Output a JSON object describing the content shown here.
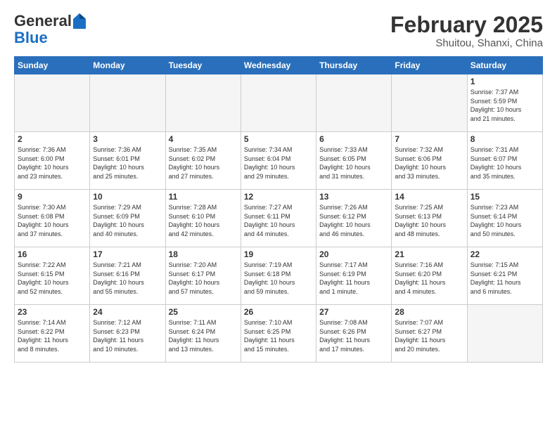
{
  "header": {
    "logo_general": "General",
    "logo_blue": "Blue",
    "month_title": "February 2025",
    "subtitle": "Shuitou, Shanxi, China"
  },
  "days_of_week": [
    "Sunday",
    "Monday",
    "Tuesday",
    "Wednesday",
    "Thursday",
    "Friday",
    "Saturday"
  ],
  "weeks": [
    [
      {
        "num": "",
        "info": ""
      },
      {
        "num": "",
        "info": ""
      },
      {
        "num": "",
        "info": ""
      },
      {
        "num": "",
        "info": ""
      },
      {
        "num": "",
        "info": ""
      },
      {
        "num": "",
        "info": ""
      },
      {
        "num": "1",
        "info": "Sunrise: 7:37 AM\nSunset: 5:59 PM\nDaylight: 10 hours\nand 21 minutes."
      }
    ],
    [
      {
        "num": "2",
        "info": "Sunrise: 7:36 AM\nSunset: 6:00 PM\nDaylight: 10 hours\nand 23 minutes."
      },
      {
        "num": "3",
        "info": "Sunrise: 7:36 AM\nSunset: 6:01 PM\nDaylight: 10 hours\nand 25 minutes."
      },
      {
        "num": "4",
        "info": "Sunrise: 7:35 AM\nSunset: 6:02 PM\nDaylight: 10 hours\nand 27 minutes."
      },
      {
        "num": "5",
        "info": "Sunrise: 7:34 AM\nSunset: 6:04 PM\nDaylight: 10 hours\nand 29 minutes."
      },
      {
        "num": "6",
        "info": "Sunrise: 7:33 AM\nSunset: 6:05 PM\nDaylight: 10 hours\nand 31 minutes."
      },
      {
        "num": "7",
        "info": "Sunrise: 7:32 AM\nSunset: 6:06 PM\nDaylight: 10 hours\nand 33 minutes."
      },
      {
        "num": "8",
        "info": "Sunrise: 7:31 AM\nSunset: 6:07 PM\nDaylight: 10 hours\nand 35 minutes."
      }
    ],
    [
      {
        "num": "9",
        "info": "Sunrise: 7:30 AM\nSunset: 6:08 PM\nDaylight: 10 hours\nand 37 minutes."
      },
      {
        "num": "10",
        "info": "Sunrise: 7:29 AM\nSunset: 6:09 PM\nDaylight: 10 hours\nand 40 minutes."
      },
      {
        "num": "11",
        "info": "Sunrise: 7:28 AM\nSunset: 6:10 PM\nDaylight: 10 hours\nand 42 minutes."
      },
      {
        "num": "12",
        "info": "Sunrise: 7:27 AM\nSunset: 6:11 PM\nDaylight: 10 hours\nand 44 minutes."
      },
      {
        "num": "13",
        "info": "Sunrise: 7:26 AM\nSunset: 6:12 PM\nDaylight: 10 hours\nand 46 minutes."
      },
      {
        "num": "14",
        "info": "Sunrise: 7:25 AM\nSunset: 6:13 PM\nDaylight: 10 hours\nand 48 minutes."
      },
      {
        "num": "15",
        "info": "Sunrise: 7:23 AM\nSunset: 6:14 PM\nDaylight: 10 hours\nand 50 minutes."
      }
    ],
    [
      {
        "num": "16",
        "info": "Sunrise: 7:22 AM\nSunset: 6:15 PM\nDaylight: 10 hours\nand 52 minutes."
      },
      {
        "num": "17",
        "info": "Sunrise: 7:21 AM\nSunset: 6:16 PM\nDaylight: 10 hours\nand 55 minutes."
      },
      {
        "num": "18",
        "info": "Sunrise: 7:20 AM\nSunset: 6:17 PM\nDaylight: 10 hours\nand 57 minutes."
      },
      {
        "num": "19",
        "info": "Sunrise: 7:19 AM\nSunset: 6:18 PM\nDaylight: 10 hours\nand 59 minutes."
      },
      {
        "num": "20",
        "info": "Sunrise: 7:17 AM\nSunset: 6:19 PM\nDaylight: 11 hours\nand 1 minute."
      },
      {
        "num": "21",
        "info": "Sunrise: 7:16 AM\nSunset: 6:20 PM\nDaylight: 11 hours\nand 4 minutes."
      },
      {
        "num": "22",
        "info": "Sunrise: 7:15 AM\nSunset: 6:21 PM\nDaylight: 11 hours\nand 6 minutes."
      }
    ],
    [
      {
        "num": "23",
        "info": "Sunrise: 7:14 AM\nSunset: 6:22 PM\nDaylight: 11 hours\nand 8 minutes."
      },
      {
        "num": "24",
        "info": "Sunrise: 7:12 AM\nSunset: 6:23 PM\nDaylight: 11 hours\nand 10 minutes."
      },
      {
        "num": "25",
        "info": "Sunrise: 7:11 AM\nSunset: 6:24 PM\nDaylight: 11 hours\nand 13 minutes."
      },
      {
        "num": "26",
        "info": "Sunrise: 7:10 AM\nSunset: 6:25 PM\nDaylight: 11 hours\nand 15 minutes."
      },
      {
        "num": "27",
        "info": "Sunrise: 7:08 AM\nSunset: 6:26 PM\nDaylight: 11 hours\nand 17 minutes."
      },
      {
        "num": "28",
        "info": "Sunrise: 7:07 AM\nSunset: 6:27 PM\nDaylight: 11 hours\nand 20 minutes."
      },
      {
        "num": "",
        "info": ""
      }
    ]
  ]
}
